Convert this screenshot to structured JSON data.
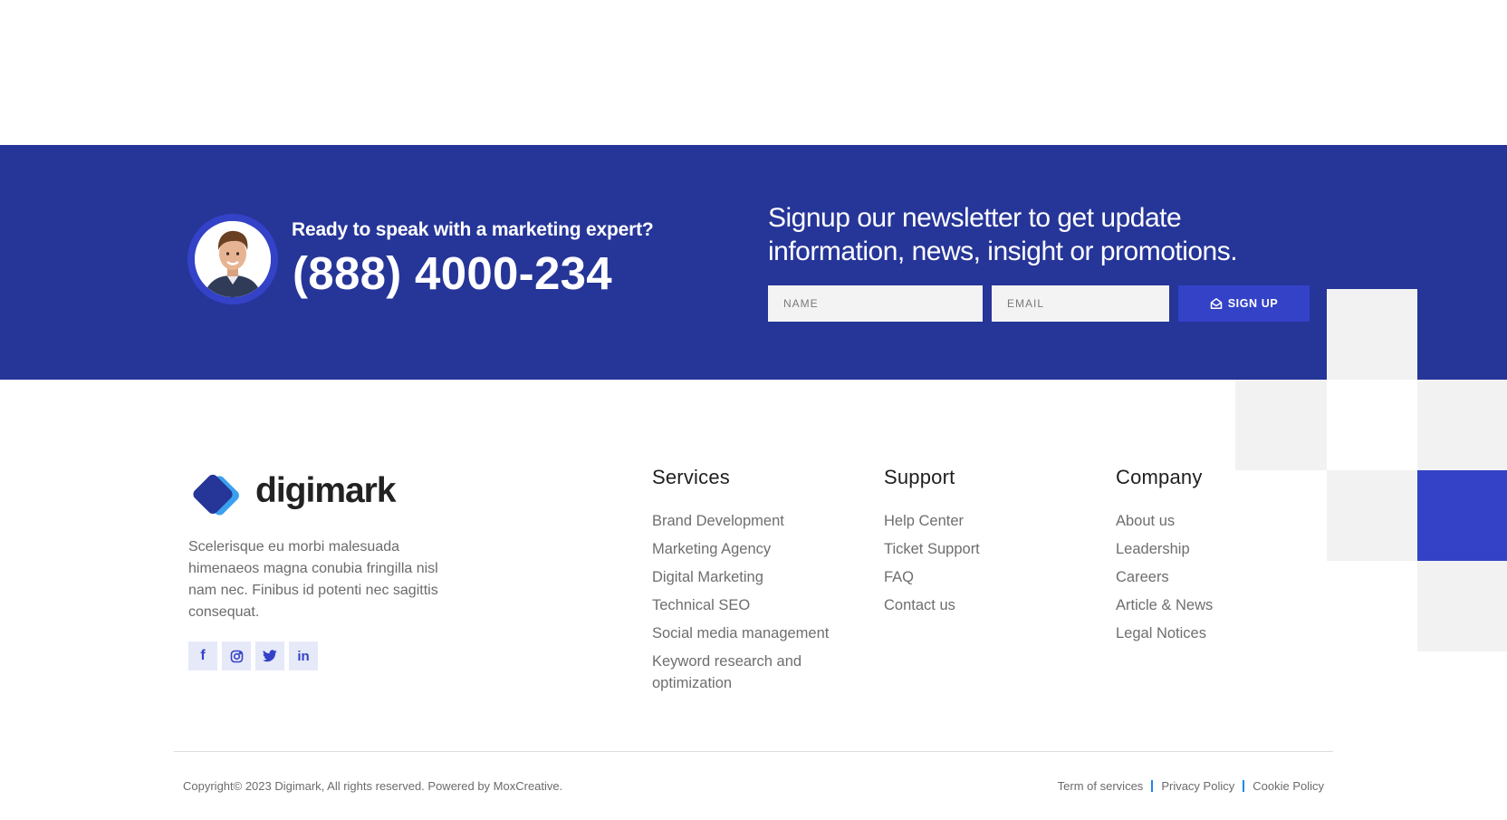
{
  "cta": {
    "question": "Ready to speak with a marketing expert?",
    "phone": "(888) 4000-234",
    "avatar_icon": "person-portrait-icon"
  },
  "newsletter": {
    "title": "Signup our newsletter to get update information, news, insight or promotions.",
    "name_placeholder": "NAME",
    "email_placeholder": "EMAIL",
    "button_label": "SIGN UP",
    "button_icon": "envelope-open-icon"
  },
  "brand": {
    "name": "digimark",
    "description": "Scelerisque eu morbi malesuada himenaeos magna conubia fringilla nisl nam nec. Finibus id potenti nec sagittis consequat.",
    "colors": {
      "primary": "#263598",
      "accent": "#3342c7",
      "light_accent": "#3aa0f0"
    }
  },
  "socials": [
    {
      "icon": "facebook-icon",
      "glyph": "f"
    },
    {
      "icon": "instagram-icon",
      "glyph": ""
    },
    {
      "icon": "twitter-icon",
      "glyph": ""
    },
    {
      "icon": "linkedin-icon",
      "glyph": "in"
    }
  ],
  "columns": {
    "services": {
      "title": "Services",
      "items": [
        "Brand Development",
        "Marketing Agency",
        "Digital Marketing",
        "Technical SEO",
        "Social media management",
        "Keyword research and optimization"
      ]
    },
    "support": {
      "title": "Support",
      "items": [
        "Help Center",
        "Ticket Support",
        "FAQ",
        "Contact us"
      ]
    },
    "company": {
      "title": "Company",
      "items": [
        "About us",
        "Leadership",
        "Careers",
        "Article & News",
        "Legal Notices"
      ]
    }
  },
  "bottom": {
    "copyright": "Copyright© 2023 Digimark, All rights reserved. Powered by MoxCreative.",
    "links": [
      "Term of services",
      "Privacy Policy",
      "Cookie Policy"
    ]
  }
}
